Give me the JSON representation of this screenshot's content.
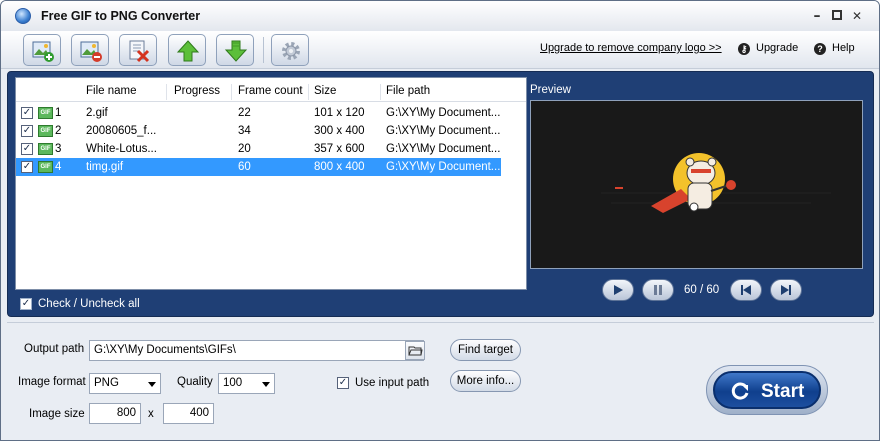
{
  "window": {
    "title": "Free GIF to PNG Converter"
  },
  "toolbar": {
    "buttons": [
      {
        "name": "add-files",
        "icon": "add-image-icon"
      },
      {
        "name": "remove-file",
        "icon": "remove-image-icon"
      },
      {
        "name": "clear-list",
        "icon": "clear-list-icon"
      },
      {
        "name": "move-up",
        "icon": "arrow-up-icon"
      },
      {
        "name": "move-down",
        "icon": "arrow-down-icon"
      },
      {
        "name": "settings",
        "icon": "gear-icon"
      }
    ],
    "upgrade_link": "Upgrade to remove company logo >>",
    "upgrade_label": "Upgrade",
    "help_label": "Help"
  },
  "file_list": {
    "columns": [
      "File name",
      "Progress",
      "Frame count",
      "Size",
      "File path"
    ],
    "rows": [
      {
        "index": "1",
        "file_name": "2.gif",
        "progress": "",
        "frame_count": "22",
        "size": "101 x 120",
        "file_path": "G:\\XY\\My Document..."
      },
      {
        "index": "2",
        "file_name": "20080605_f...",
        "progress": "",
        "frame_count": "34",
        "size": "300 x 400",
        "file_path": "G:\\XY\\My Document..."
      },
      {
        "index": "3",
        "file_name": "White-Lotus...",
        "progress": "",
        "frame_count": "20",
        "size": "357 x 600",
        "file_path": "G:\\XY\\My Document..."
      },
      {
        "index": "4",
        "file_name": "timg.gif",
        "progress": "",
        "frame_count": "60",
        "size": "800 x 400",
        "file_path": "G:\\XY\\My Document..."
      }
    ],
    "selected_index": 3,
    "check_all_label": "Check / Uncheck all"
  },
  "preview": {
    "label": "Preview",
    "frame_counter": "60 / 60"
  },
  "options": {
    "output_path_label": "Output path",
    "output_path_value": "G:\\XY\\My Documents\\GIFs\\",
    "find_target_label": "Find target",
    "image_format_label": "Image format",
    "image_format_value": "PNG",
    "quality_label": "Quality",
    "quality_value": "100",
    "use_input_path_label": "Use input path",
    "more_info_label": "More info...",
    "image_size_label": "Image size",
    "width_value": "800",
    "times_symbol": "x",
    "height_value": "400",
    "start_label": "Start"
  },
  "colors": {
    "panel_blue": "#1f3f75",
    "selection": "#3399ff",
    "start_blue": "#0f3f8d"
  }
}
